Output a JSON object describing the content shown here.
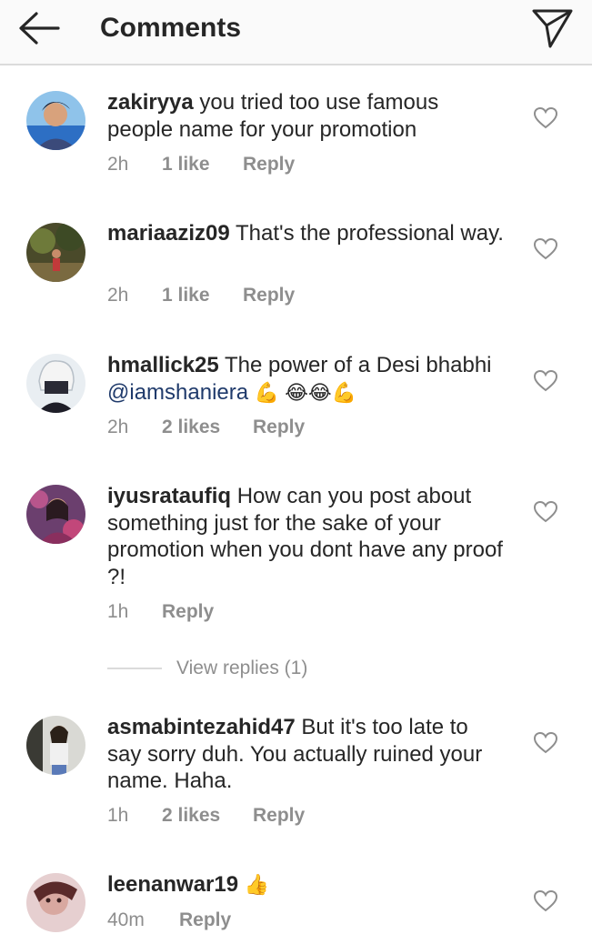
{
  "header": {
    "title": "Comments",
    "back_icon": "arrow-left-icon",
    "send_icon": "paper-plane-icon"
  },
  "colors": {
    "username": "#262626",
    "meta": "#8e8e8e",
    "mention": "#1f3a6b",
    "divider": "#dbdbdb"
  },
  "comments": [
    {
      "username": "zakiryya",
      "text": "you tried too use famous people name for your promotion",
      "time": "2h",
      "likes": "1 like",
      "reply": "Reply"
    },
    {
      "username": "mariaaziz09",
      "text": "That's the professional way.",
      "time": "2h",
      "likes": "1 like",
      "reply": "Reply"
    },
    {
      "username": "hmallick25",
      "text_before": "The power of a Desi bhabhi",
      "mention": "@iamshaniera",
      "emojis": "💪 😂😂💪",
      "time": "2h",
      "likes": "2 likes",
      "reply": "Reply"
    },
    {
      "username": "iyusrataufiq",
      "text": "How can you post about something just for the sake of your promotion when you dont have any proof ?!",
      "time": "1h",
      "reply": "Reply",
      "view_replies": "View replies (1)"
    },
    {
      "username": "asmabintezahid47",
      "text": "But it's too late to say sorry duh. You actually ruined your name. Haha.",
      "time": "1h",
      "likes": "2 likes",
      "reply": "Reply"
    },
    {
      "username": "leenanwar19",
      "emoji": "👍",
      "time": "40m",
      "reply": "Reply"
    }
  ]
}
